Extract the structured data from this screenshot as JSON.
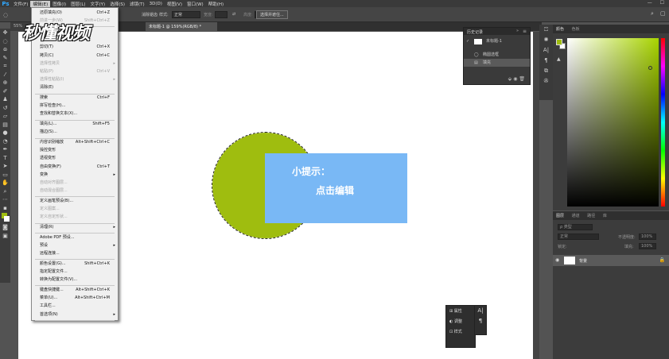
{
  "menubar": {
    "logo": "Ps",
    "items": [
      "文件(F)",
      "编辑(E)",
      "图像(I)",
      "图层(L)",
      "文字(Y)",
      "选择(S)",
      "滤镜(T)",
      "3D(D)",
      "视图(V)",
      "窗口(W)",
      "帮助(H)"
    ],
    "window_controls": "— ☐"
  },
  "options": {
    "blend_label": "消除锯齿",
    "style_label": "样式:",
    "style_value": "正常",
    "width_label": "宽度:",
    "height_label": "高度:",
    "select_mask_button": "选择并遮住..."
  },
  "tabs": [
    {
      "label": "55%"
    },
    {
      "label": "未标题-1 @ 159%(RGB/8) *"
    }
  ],
  "watermark": "秒懂视频",
  "edit_menu": {
    "items": [
      {
        "label": "还原填充(O)",
        "shortcut": "Ctrl+Z",
        "disabled": false
      },
      {
        "label": "前进一步(W)",
        "shortcut": "Shift+Ctrl+Z",
        "disabled": true
      },
      {
        "label": "",
        "shortcut": "",
        "disabled": true
      },
      {
        "label": "",
        "shortcut": "",
        "disabled": true
      },
      {
        "label": "剪切(T)",
        "shortcut": "Ctrl+X",
        "disabled": false
      },
      {
        "label": "拷贝(C)",
        "shortcut": "Ctrl+C",
        "disabled": false
      },
      {
        "label": "选择性拷贝",
        "shortcut": "",
        "disabled": true,
        "submenu": true
      },
      {
        "label": "粘贴(P)",
        "shortcut": "Ctrl+V",
        "disabled": true
      },
      {
        "label": "选择性粘贴(I)",
        "shortcut": "",
        "disabled": true,
        "submenu": true
      },
      {
        "label": "清除(E)",
        "shortcut": "",
        "disabled": false
      },
      {
        "label": "搜索",
        "shortcut": "Ctrl+F",
        "disabled": false
      },
      {
        "label": "拼写检查(H)...",
        "shortcut": "",
        "disabled": false
      },
      {
        "label": "查找和替换文本(X)...",
        "shortcut": "",
        "disabled": false
      },
      {
        "label": "填充(L)...",
        "shortcut": "Shift+F5",
        "disabled": false
      },
      {
        "label": "描边(S)...",
        "shortcut": "",
        "disabled": false
      },
      {
        "label": "内容识别缩放",
        "shortcut": "Alt+Shift+Ctrl+C",
        "disabled": false
      },
      {
        "label": "操控变形",
        "shortcut": "",
        "disabled": false
      },
      {
        "label": "透视变形",
        "shortcut": "",
        "disabled": false
      },
      {
        "label": "自由变换(F)",
        "shortcut": "Ctrl+T",
        "disabled": false
      },
      {
        "label": "变换",
        "shortcut": "",
        "disabled": false,
        "submenu": true
      },
      {
        "label": "自动对齐图层...",
        "shortcut": "",
        "disabled": true
      },
      {
        "label": "自动混合图层...",
        "shortcut": "",
        "disabled": true
      },
      {
        "label": "定义画笔预设(B)...",
        "shortcut": "",
        "disabled": false
      },
      {
        "label": "定义图案...",
        "shortcut": "",
        "disabled": true
      },
      {
        "label": "定义自定形状...",
        "shortcut": "",
        "disabled": true
      },
      {
        "label": "清理(R)",
        "shortcut": "",
        "disabled": false,
        "submenu": true
      },
      {
        "label": "Adobe PDF 预设...",
        "shortcut": "",
        "disabled": false
      },
      {
        "label": "预设",
        "shortcut": "",
        "disabled": false,
        "submenu": true
      },
      {
        "label": "远程连接...",
        "shortcut": "",
        "disabled": false
      },
      {
        "label": "颜色设置(G)...",
        "shortcut": "Shift+Ctrl+K",
        "disabled": false
      },
      {
        "label": "指定配置文件...",
        "shortcut": "",
        "disabled": false
      },
      {
        "label": "转换为配置文件(V)...",
        "shortcut": "",
        "disabled": false
      },
      {
        "label": "键盘快捷键...",
        "shortcut": "Alt+Shift+Ctrl+K",
        "disabled": false
      },
      {
        "label": "菜单(U)...",
        "shortcut": "Alt+Shift+Ctrl+M",
        "disabled": false
      },
      {
        "label": "工具栏...",
        "shortcut": "",
        "disabled": false
      },
      {
        "label": "首选项(N)",
        "shortcut": "",
        "disabled": false,
        "submenu": true
      }
    ]
  },
  "hint_box": {
    "line1": "小提示：",
    "line2": "点击编辑"
  },
  "history": {
    "title": "历史记录",
    "items": [
      "未标题-1",
      "椭圆选框",
      "填充"
    ]
  },
  "color_panel": {
    "tabs": [
      "颜色",
      "色板"
    ]
  },
  "layers_panel": {
    "tabs": [
      "图层",
      "通道",
      "路径",
      "库"
    ],
    "filter_label": "ρ 类型",
    "blend_mode": "正常",
    "opacity_label": "不透明度:",
    "opacity_value": "100%",
    "lock_label": "锁定:",
    "fill_label": "填充:",
    "fill_value": "100%",
    "layer_name": "背景"
  },
  "mini_panel": {
    "items": [
      "属性",
      "调整",
      "样式"
    ]
  },
  "colors": {
    "circle": "#9fbd0f",
    "hint_bg": "#79b8f5",
    "ps_blue": "#31a8ff"
  }
}
